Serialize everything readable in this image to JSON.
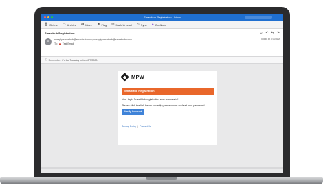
{
  "window": {
    "title": "SmartHub Registration - Inbox",
    "traffic_colors": [
      "#ff5f57",
      "#febc2e",
      "#28c840"
    ]
  },
  "toolbar": {
    "items": [
      {
        "icon": "delete-icon",
        "label": "Delete"
      },
      {
        "icon": "archive-icon",
        "label": "Archive"
      },
      {
        "icon": "move-icon",
        "label": "Move"
      },
      {
        "icon": "flag-icon",
        "label": "Flag"
      },
      {
        "icon": "mark-unread-icon",
        "label": "Mark Unread"
      },
      {
        "icon": "sync-icon",
        "label": "Sync"
      },
      {
        "icon": "onenote-icon",
        "label": "OneNote"
      }
    ],
    "more": "···"
  },
  "message": {
    "subject": "SmartHub Registration",
    "avatar_initial": "M",
    "from": "noreply-smarthub@smarthub.coop; noreply-smarthub@smarthub.coop",
    "to_label": "To:",
    "to_name": "Test Email",
    "date": "Today at 8:00 AM",
    "header_actions": [
      "☺",
      "↶",
      "⇆",
      "↷"
    ]
  },
  "notice": {
    "text": "Remember: it's the Tuesday before 8/7/2020."
  },
  "email": {
    "logo_text": "MPW",
    "banner": "SmartHub Registration",
    "line1": "Your login SmartHub registration was successful!",
    "line2": "Please click the link below to verify your account and set your password.",
    "button": "Verify Account",
    "link1": "Privacy Policy",
    "link_sep": "|",
    "link2": "Contact Us",
    "accent_color": "#e9672b",
    "button_color": "#3f83d8"
  }
}
